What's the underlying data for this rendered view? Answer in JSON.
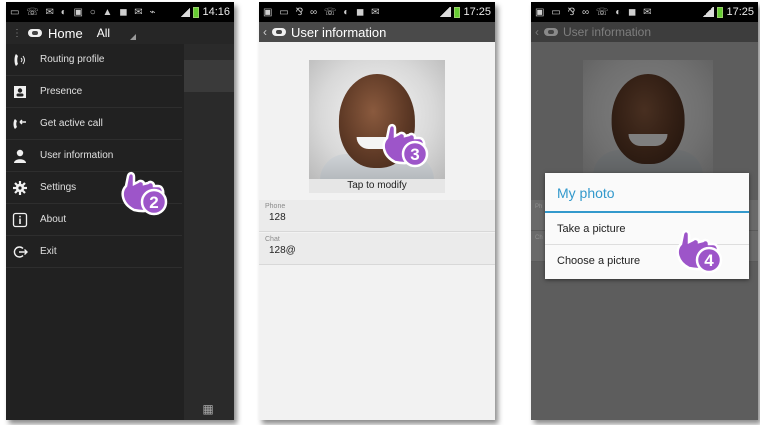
{
  "screen1": {
    "status_time": "14:16",
    "header": {
      "title": "Home",
      "filter": "All"
    },
    "menu": [
      {
        "label": "Routing profile",
        "icon": "phone-handset-icon"
      },
      {
        "label": "Presence",
        "icon": "contact-card-icon"
      },
      {
        "label": "Get active call",
        "icon": "call-pickup-icon"
      },
      {
        "label": "User information",
        "icon": "user-icon"
      },
      {
        "label": "Settings",
        "icon": "gear-icon"
      },
      {
        "label": "About",
        "icon": "info-icon"
      },
      {
        "label": "Exit",
        "icon": "exit-icon"
      }
    ],
    "step": "2"
  },
  "screen2": {
    "status_time": "17:25",
    "header": {
      "title": "User information"
    },
    "tap_caption": "Tap to modify",
    "fields": [
      {
        "label": "Phone",
        "value": "128"
      },
      {
        "label": "Chat",
        "value": "128@"
      }
    ],
    "step": "3"
  },
  "screen3": {
    "status_time": "17:25",
    "header": {
      "title": "User information"
    },
    "background_labels": [
      "Ph",
      "Ch"
    ],
    "dialog": {
      "title": "My photo",
      "options": [
        "Take a picture",
        "Choose a picture"
      ]
    },
    "step": "4"
  },
  "colors": {
    "accent_blue": "#3399cc",
    "hand_purple": "#9d55c9",
    "battery_green": "#66cc33"
  }
}
